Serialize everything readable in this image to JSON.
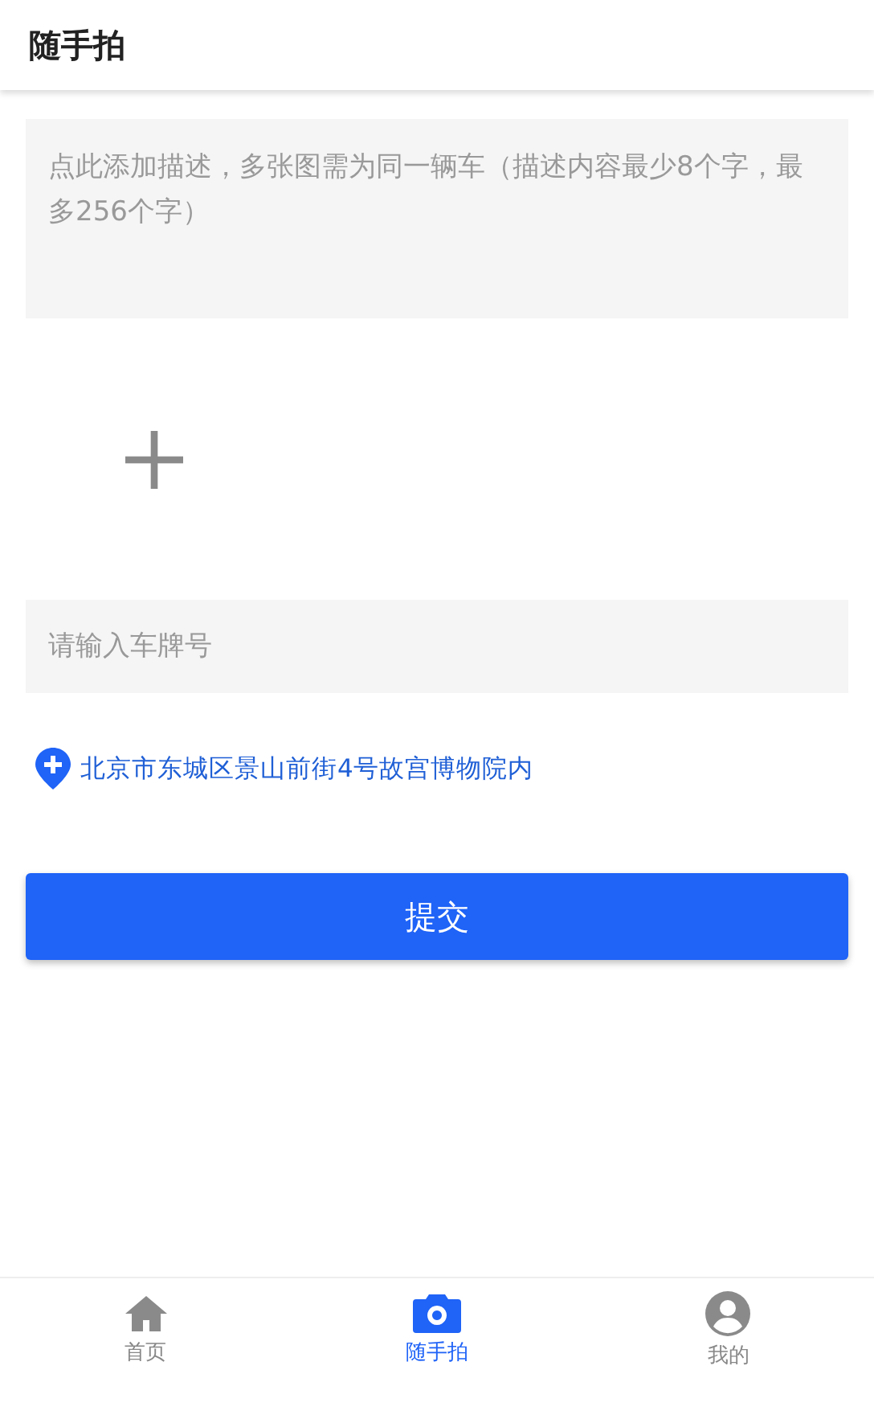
{
  "header": {
    "title": "随手拍"
  },
  "description": {
    "placeholder": "点此添加描述，多张图需为同一辆车（描述内容最少8个字，最多256个字）"
  },
  "plate": {
    "placeholder": "请输入车牌号"
  },
  "location": {
    "text": "北京市东城区景山前街4号故宫博物院内"
  },
  "submit": {
    "label": "提交"
  },
  "tabs": [
    {
      "label": "首页",
      "selected": false
    },
    {
      "label": "随手拍",
      "selected": true
    },
    {
      "label": "我的",
      "selected": false
    }
  ]
}
